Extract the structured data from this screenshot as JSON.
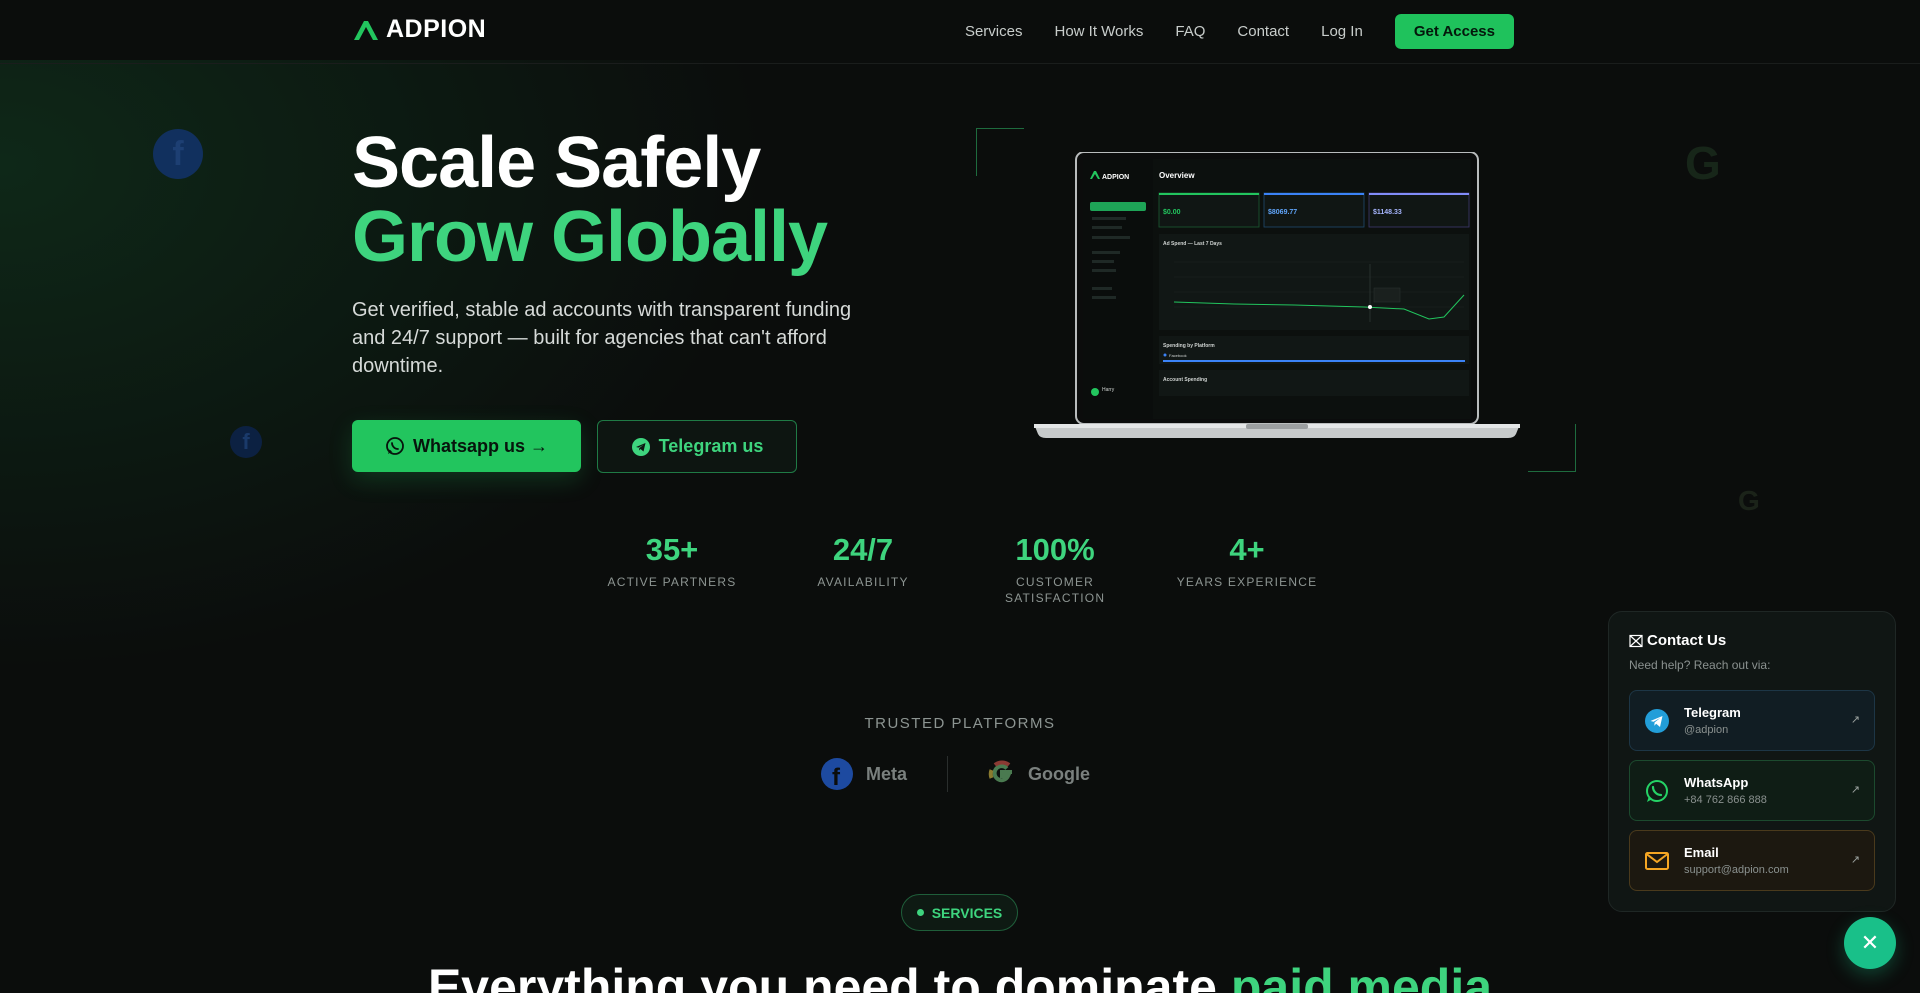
{
  "nav": {
    "logo_text": "ADPION",
    "links": [
      "Services",
      "How It Works",
      "FAQ",
      "Contact",
      "Log In"
    ],
    "cta": "Get Access"
  },
  "hero": {
    "title_line1": "Scale Safely",
    "title_line2": "Grow Globally",
    "subtitle": "Get verified, stable ad accounts with transparent funding and 24/7 support — built for agencies that can't afford downtime.",
    "whatsapp_button": "Whatsapp us →",
    "telegram_button": "Telegram us"
  },
  "dashboard": {
    "logo": "ADPION",
    "title": "Overview",
    "card_values": [
      "$0.00",
      "$8069.77",
      "$1148.33"
    ],
    "chart_title": "Ad Spend — Last 7 Days",
    "platform_title": "Spending by Platform",
    "platform_item": "Facebook",
    "account_title": "Account Spending",
    "user": "Harry"
  },
  "stats": [
    {
      "value": "35+",
      "label": "Active Partners"
    },
    {
      "value": "24/7",
      "label": "Availability"
    },
    {
      "value": "100%",
      "label": "Customer Satisfaction"
    },
    {
      "value": "4+",
      "label": "Years Experience"
    }
  ],
  "trusted": {
    "heading": "TRUSTED PLATFORMS",
    "platforms": [
      "Meta",
      "Google"
    ]
  },
  "services": {
    "pill": "SERVICES",
    "title_start": "Everything you need to dominate ",
    "title_highlight": "paid media"
  },
  "contact_widget": {
    "title": "Contact Us",
    "subtitle": "Need help? Reach out via:",
    "items": [
      {
        "name": "Telegram",
        "value": "@adpion",
        "icon": "telegram-icon"
      },
      {
        "name": "WhatsApp",
        "value": "+84 762 866 888",
        "icon": "whatsapp-icon"
      },
      {
        "name": "Email",
        "value": "support@adpion.com",
        "icon": "mail-icon"
      }
    ],
    "close": "✕"
  },
  "colors": {
    "accent": "#22c55e",
    "accent_text": "#3ed47e",
    "background": "#0b0d0c"
  }
}
